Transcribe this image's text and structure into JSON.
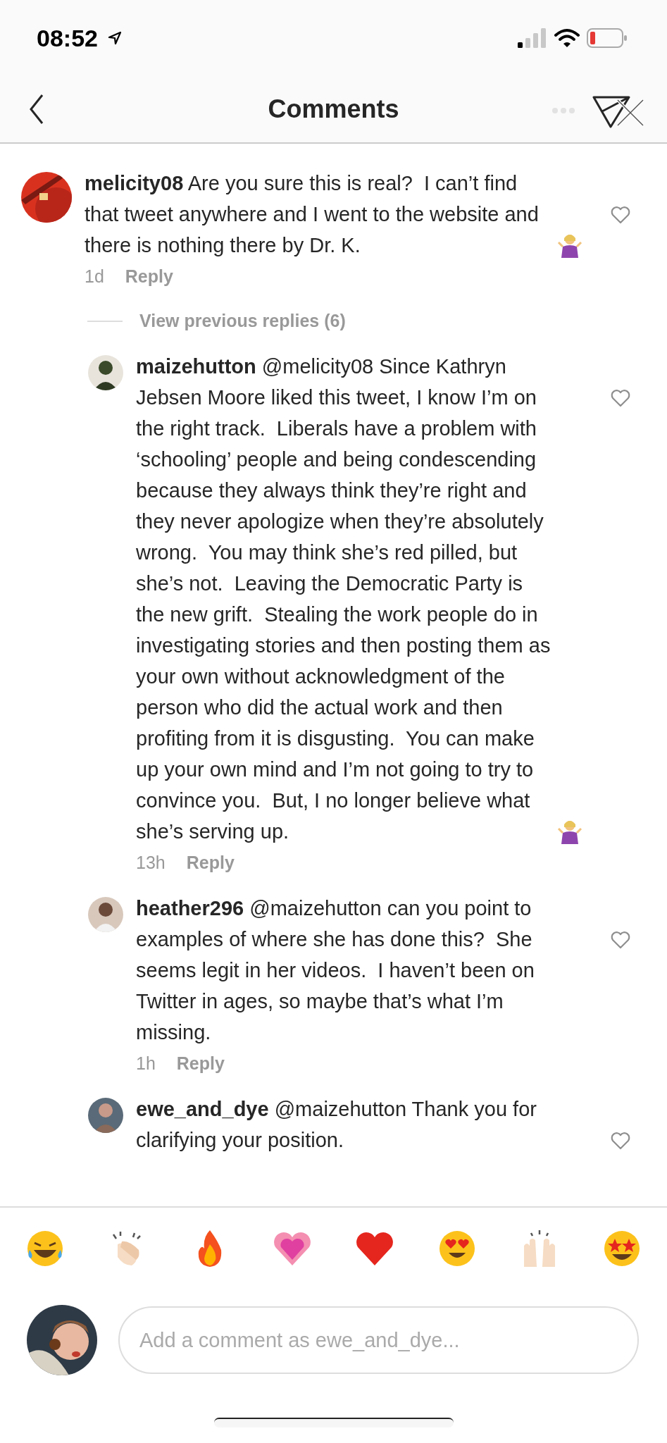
{
  "status_bar": {
    "time": "08:52"
  },
  "header": {
    "title": "Comments"
  },
  "comments": [
    {
      "text": "**melicity08** Are you sure this is real?  I can’t find that tweet anywhere and I went to the website and there is nothing there by Dr. K.",
      "shrug": true,
      "time": "1d",
      "reply": "Reply",
      "view_replies": "View previous replies (6)",
      "replies": [
        {
          "text": "**maizehutton** @melicity08 Since Kathryn Jebsen Moore liked this tweet, I know I’m on the right track.  Liberals have a problem with ‘schooling’ people and being condescending because they always think they’re right and they never apologize when they’re absolutely wrong.  You may think she’s red pilled, but she’s not.  Leaving the Democratic Party is the new grift.  Stealing the work people do in investigating stories and then posting them as your own without acknowledgment of the person who did the actual work and then profiting from it is disgusting.  You can make up your own mind and I’m not going to try to convince you.  But, I no longer believe what she’s serving up.",
          "shrug": true,
          "time": "13h",
          "reply": "Reply"
        },
        {
          "text": "**heather296** @maizehutton can you point to examples of where she has done this?  She seems legit in her videos.  I haven’t been on Twitter in ages, so maybe that’s what I’m missing.",
          "shrug": false,
          "time": "1h",
          "reply": "Reply"
        },
        {
          "text": "**ewe_and_dye** @maizehutton Thank you for clarifying your position.",
          "shrug": false
        }
      ]
    }
  ],
  "composer": {
    "placeholder": "Add a comment as ewe_and_dye..."
  }
}
